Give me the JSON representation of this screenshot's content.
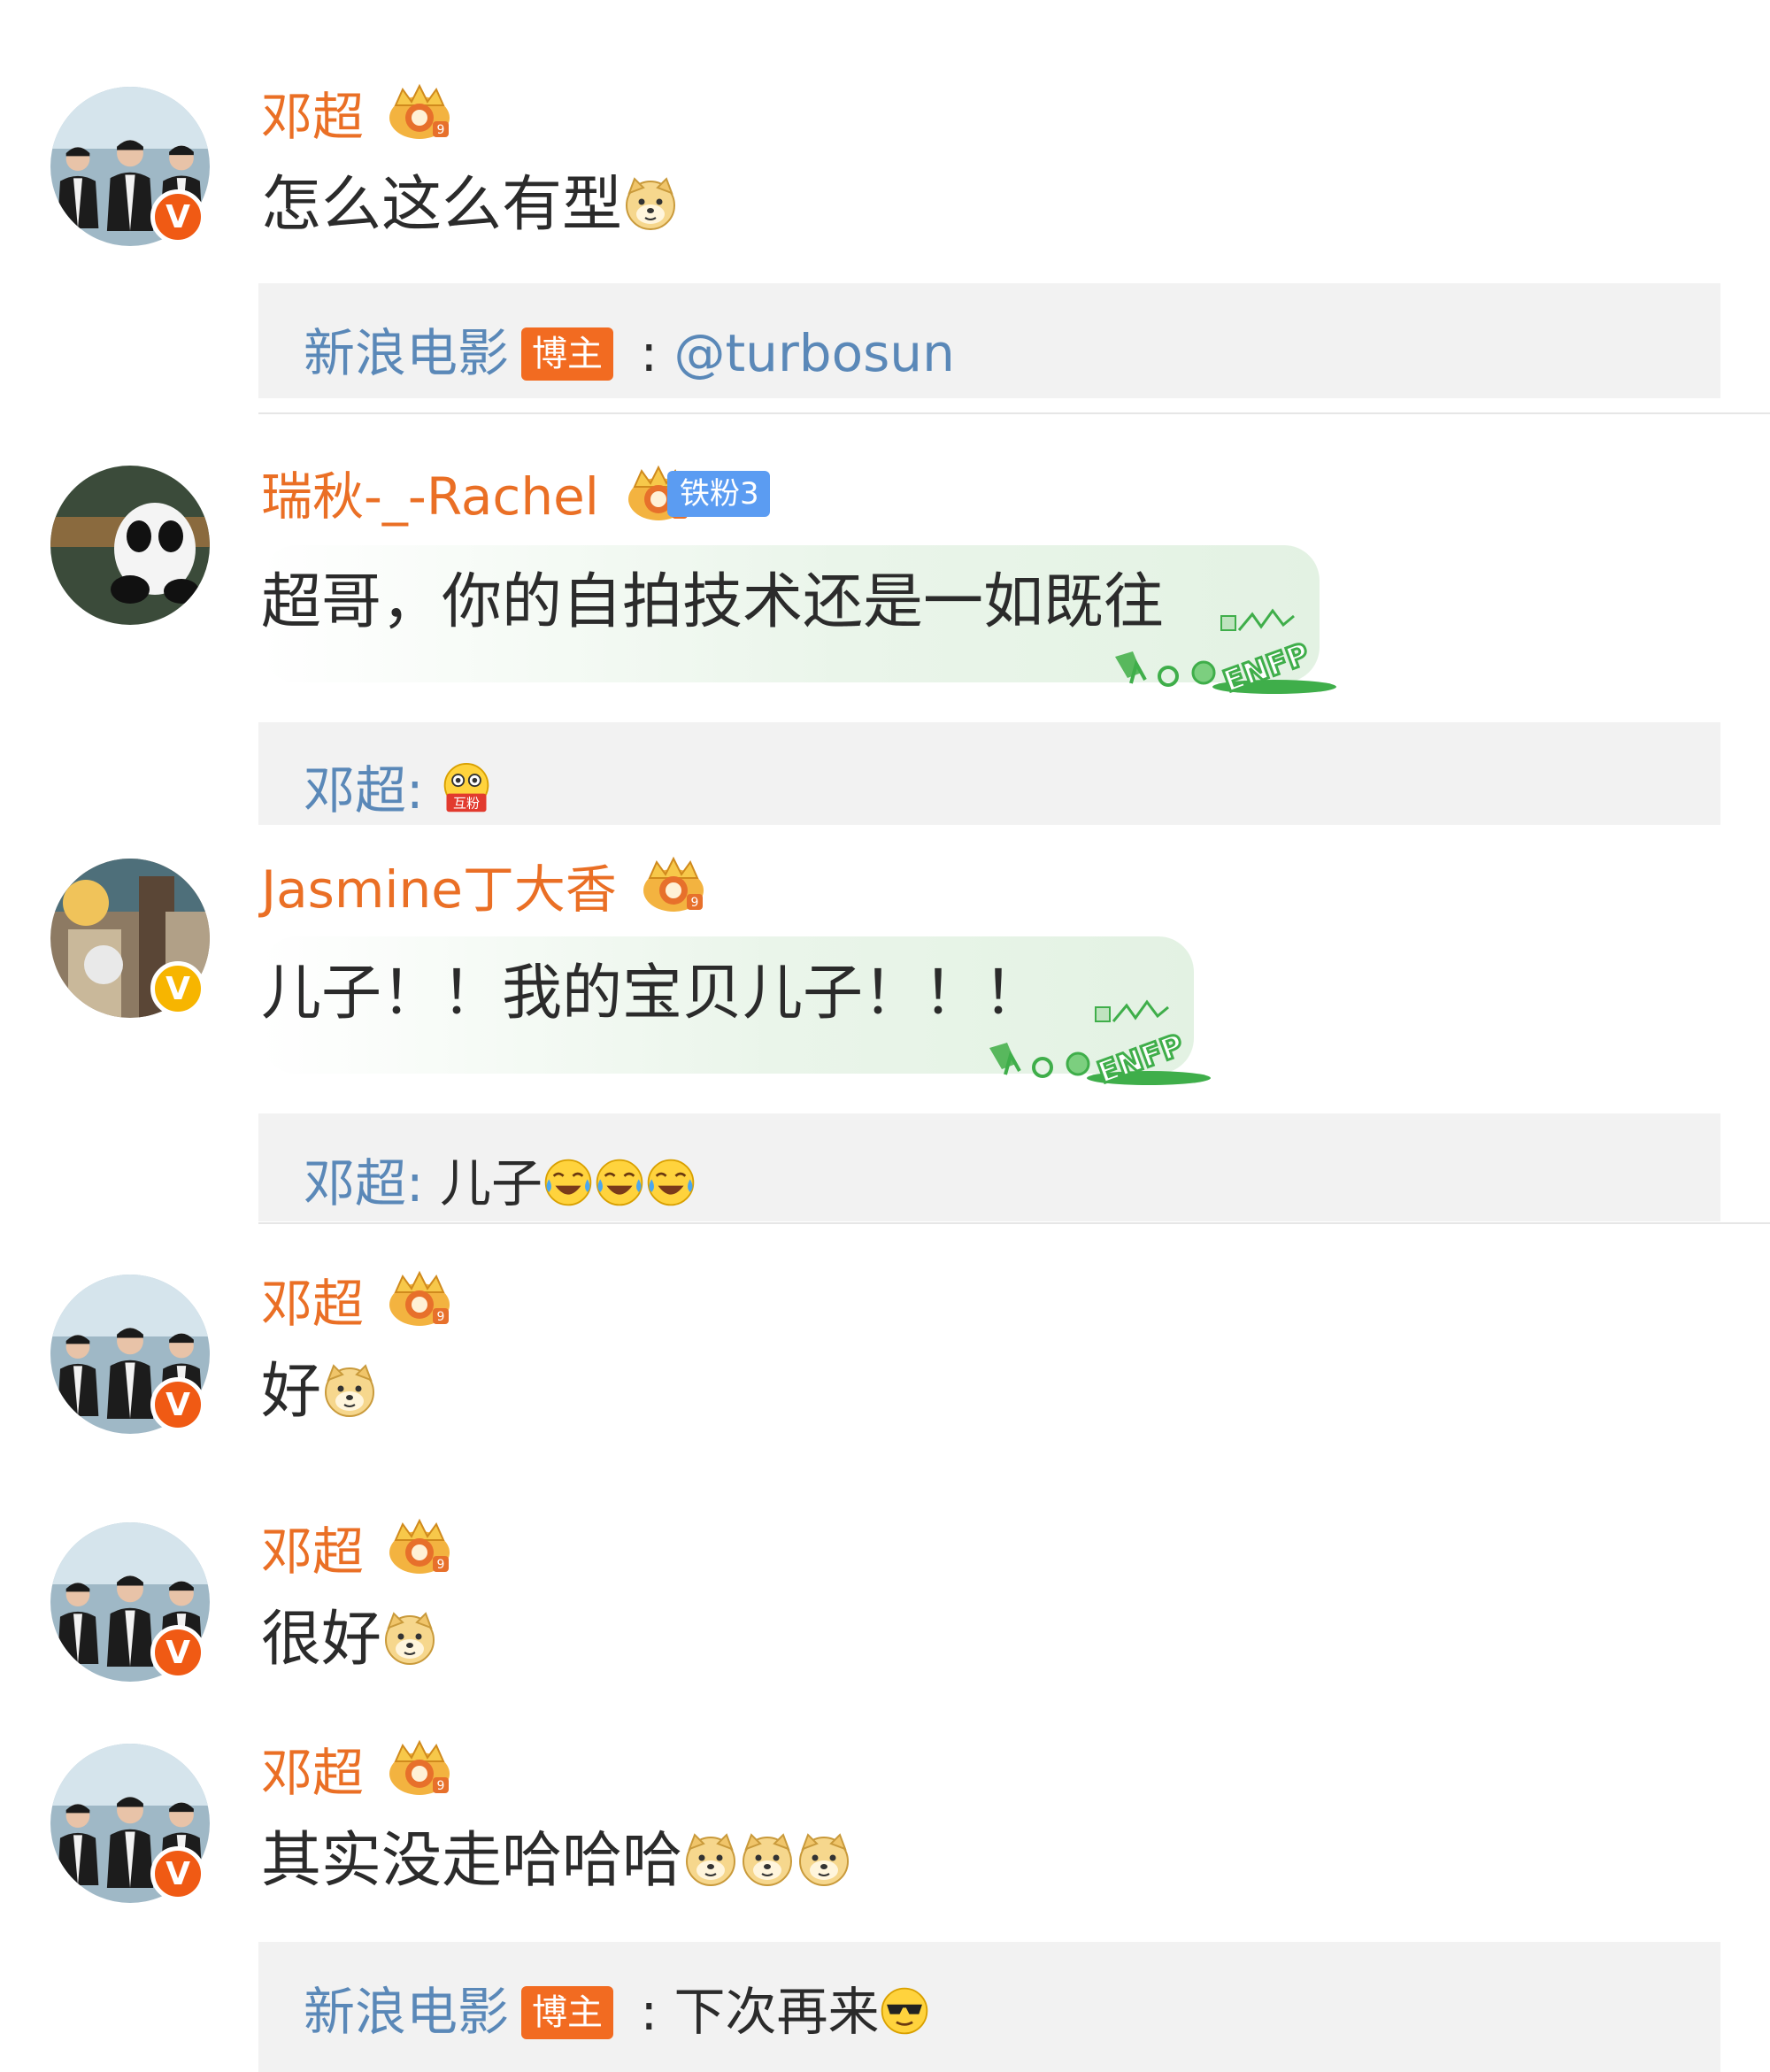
{
  "comments": [
    {
      "user": "邓超",
      "text": "怎么这么有型",
      "emoji": "doge"
    },
    {
      "user": "瑞秋-_-Rachel",
      "fan_badge": "铁粉3",
      "text": "超哥，你的自拍技术还是一如既往",
      "card": "ENFP"
    },
    {
      "user": "Jasmine丁大香",
      "text": "儿子！！我的宝贝儿子！！！",
      "card": "ENFP"
    },
    {
      "user": "邓超",
      "text": "好",
      "emoji": "doge"
    },
    {
      "user": "邓超",
      "text": "很好",
      "emoji": "doge"
    },
    {
      "user": "邓超",
      "text": "其实没走哈哈哈",
      "emoji": "doge x3"
    }
  ],
  "replies": [
    {
      "name": "新浪电影",
      "badge": "博主",
      "text": "@turbosun"
    },
    {
      "name": "邓超:",
      "emoji": "mutual-fan",
      "emoji_label": "互粉"
    },
    {
      "name": "邓超:",
      "text": "儿子",
      "emoji": "laugh-cry x3"
    },
    {
      "name": "新浪电影",
      "badge": "博主",
      "text": "下次再来",
      "emoji": "cool-sunglasses"
    }
  ],
  "colors": {
    "username": "#ea6f25",
    "reply_name": "#5a88b8",
    "blogger_badge": "#f26b21",
    "fan_badge": "#5b9cf2",
    "verified_orange": "#f05a14",
    "verified_gold": "#f7b500"
  }
}
